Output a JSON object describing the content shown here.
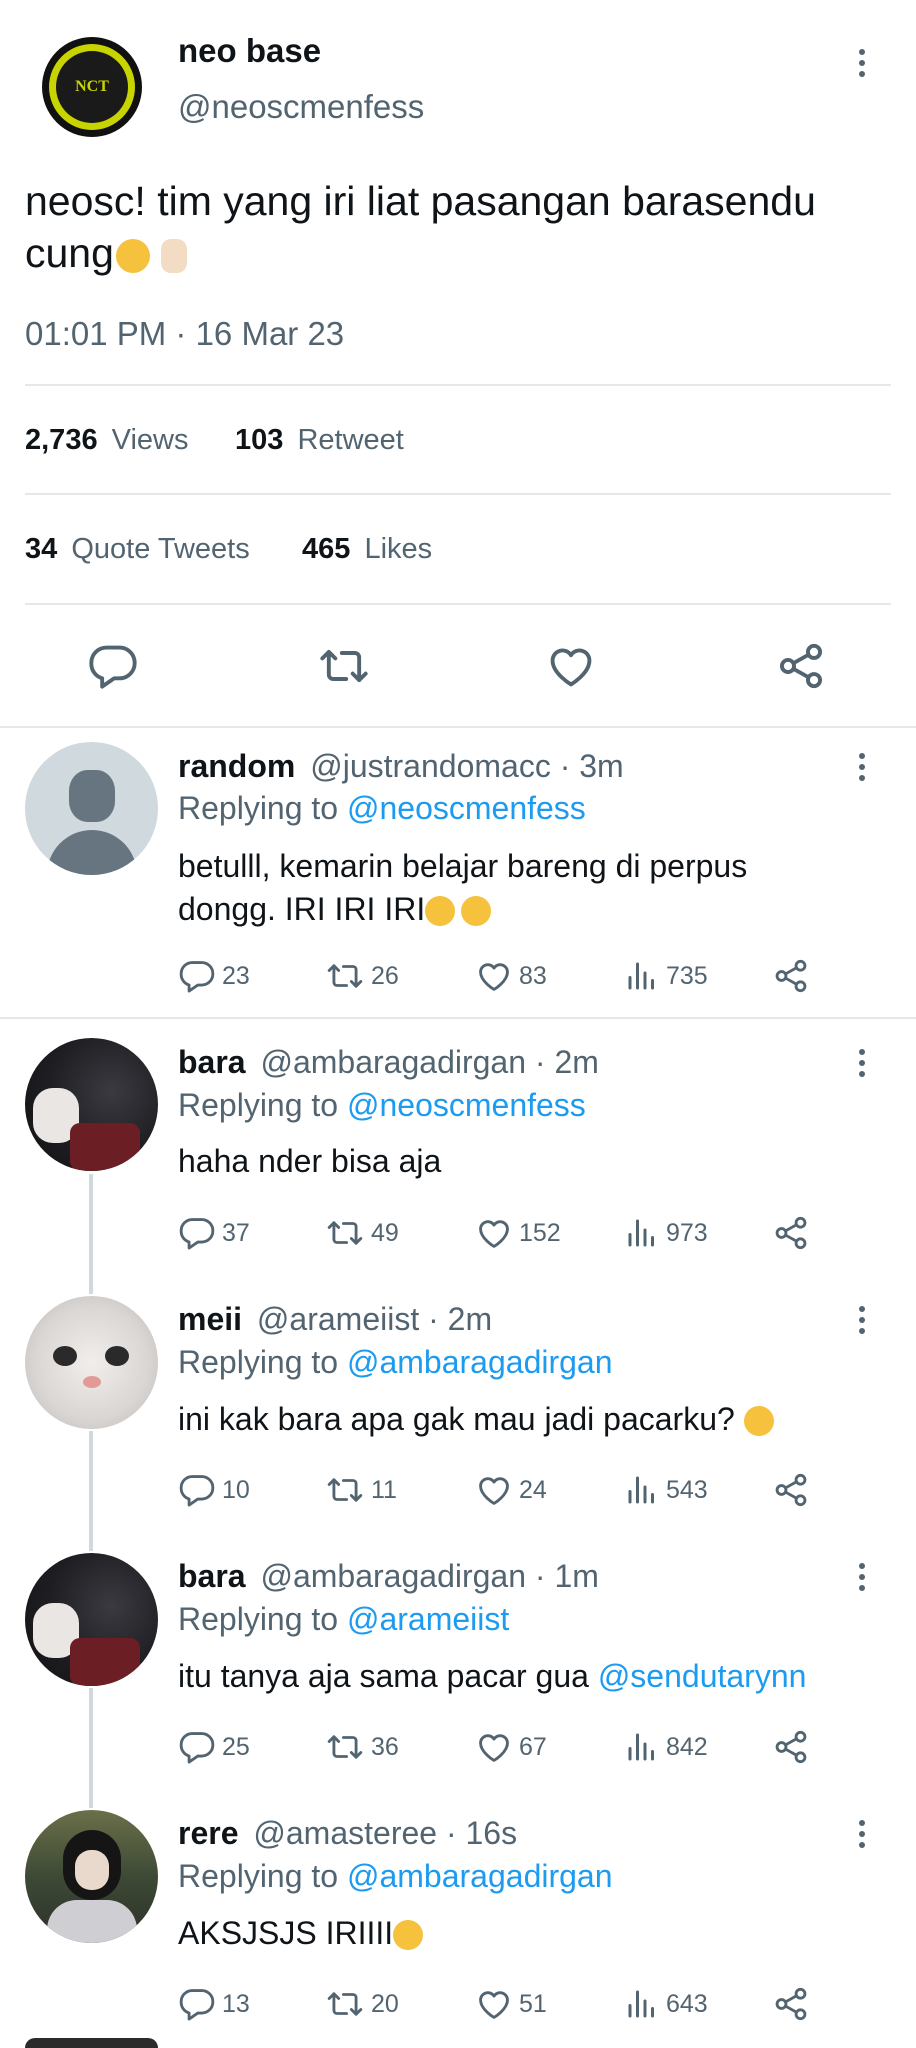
{
  "main_tweet": {
    "display_name": "neo base",
    "handle": "@neoscmenfess",
    "avatar_text": "NCT",
    "text": "neosc! tim yang iri liat pasangan barasendu cung",
    "timestamp": "01:01 PM · 16 Mar 23",
    "views_count": "2,736",
    "views_label": "Views",
    "retweet_count": "103",
    "retweet_label": "Retweet",
    "quote_count": "34",
    "quote_label": "Quote Tweets",
    "likes_count": "465",
    "likes_label": "Likes"
  },
  "replies": [
    {
      "name": "random",
      "handle": "@justrandomacc",
      "time": "· 3m",
      "replying_prefix": "Replying to",
      "replying_to": "@neoscmenfess",
      "text_line1": "betulll, kemarin belajar bareng di perpus",
      "text_line2": "dongg. IRI IRI IRI",
      "reply": "23",
      "retweets": "26",
      "likes": "83",
      "views": "735"
    },
    {
      "name": "bara",
      "handle": "@ambaragadirgan",
      "time": "· 2m",
      "replying_prefix": "Replying to",
      "replying_to": "@neoscmenfess",
      "text": "haha nder bisa aja",
      "reply": "37",
      "retweets": "49",
      "likes": "152",
      "views": "973"
    },
    {
      "name": "meii",
      "handle": "@arameiist",
      "time": "· 2m",
      "replying_prefix": "Replying to",
      "replying_to": "@ambaragadirgan",
      "text": "ini kak bara apa gak mau jadi pacarku?",
      "reply": "10",
      "retweets": "11",
      "likes": "24",
      "views": "543"
    },
    {
      "name": "bara",
      "handle": "@ambaragadirgan",
      "time": "· 1m",
      "replying_prefix": "Replying to",
      "replying_to": "@arameiist",
      "text": "itu tanya aja sama pacar gua",
      "mention": "@sendutarynn",
      "reply": "25",
      "retweets": "36",
      "likes": "67",
      "views": "842"
    },
    {
      "name": "rere",
      "handle": "@amasteree",
      "time": "· 16s",
      "replying_prefix": "Replying to",
      "replying_to": "@ambaragadirgan",
      "text": "AKSJSJS IRIIII",
      "reply": "13",
      "retweets": "20",
      "likes": "51",
      "views": "643"
    }
  ],
  "icons": {
    "reply": "reply-bubble-icon",
    "retweet": "retweet-icon",
    "like": "heart-icon",
    "views": "views-bar-icon",
    "share": "share-icon",
    "more": "more-vertical-icon"
  },
  "colors": {
    "link": "#1d9bf0",
    "muted": "#536471",
    "text": "#0f1419",
    "divider": "#e4e8eb",
    "nct_green": "#c8d400"
  }
}
